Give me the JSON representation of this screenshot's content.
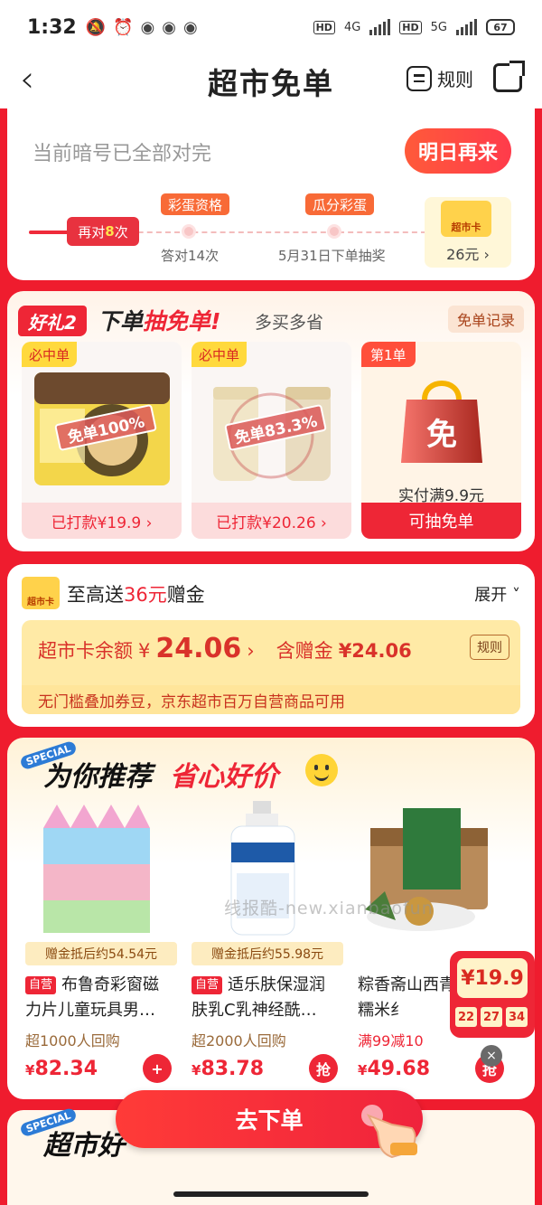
{
  "status": {
    "time": "1:32",
    "net1": "4G",
    "net2": "5G",
    "hd": "HD",
    "battery": "67"
  },
  "nav": {
    "title": "超市免单",
    "rules": "规则"
  },
  "quiz": {
    "done_text": "当前暗号已全部对完",
    "tomorrow_btn": "明日再来",
    "again_prefix": "再对",
    "again_count": "8",
    "again_suffix": "次",
    "milestone1_tag": "彩蛋资格",
    "milestone1_sub": "答对14次",
    "milestone2_tag": "瓜分彩蛋",
    "milestone2_sub": "5月31日下单抽奖",
    "card_label": "超市卡",
    "card_amount": "26元",
    "card_arrow": "›"
  },
  "gift2": {
    "badge": "好礼2",
    "title_a": "下单",
    "title_b": "抽免单!",
    "subtitle": "多买多省",
    "records": "免单记录",
    "products": [
      {
        "tag": "必中单",
        "stamp": "免单100%",
        "footer": "已打款¥19.9 ›"
      },
      {
        "tag": "必中单",
        "stamp": "免单83.3%",
        "footer": "已打款¥20.26 ›"
      }
    ],
    "free_card": {
      "tag": "第1单",
      "bag_text": "免",
      "pay": "实付满9.9元",
      "footer": "可抽免单"
    }
  },
  "supercard": {
    "icon_label": "超市卡",
    "title_prefix": "至高送",
    "title_amount": "36元",
    "title_suffix": "赠金",
    "expand": "展开 ˅",
    "balance_label": "超市卡余额",
    "balance_currency": "¥",
    "balance_value": "24.06",
    "balance_arrow": "›",
    "gift_label": "含赠金",
    "gift_value": "¥24.06",
    "rules": "规则",
    "note": "无门槛叠加券豆，京东超市百万自营商品可用"
  },
  "recommend": {
    "special": "SPECIAL",
    "title_a": "为你推荐",
    "title_b": "省心好价",
    "items": [
      {
        "gift": "赠金抵后约54.54元",
        "self": "自营",
        "name": "布鲁奇彩窗磁力片儿童玩具男…",
        "buyers": "超1000人回购",
        "price": "82.34",
        "btn": "+"
      },
      {
        "gift": "赠金抵后约55.98元",
        "self": "自营",
        "name": "适乐肤保湿润肤乳C乳神经酰…",
        "buyers": "超2000人回购",
        "price": "83.78",
        "btn": "抢"
      },
      {
        "gift": "",
        "self": "",
        "name": "粽香斋山西青子江米糯米纟",
        "buyers": "满99减10",
        "price": "49.68",
        "btn": "抢"
      }
    ]
  },
  "floating": {
    "amount": "¥19.9",
    "h": "22",
    "m": "27",
    "s": "34",
    "close": "×"
  },
  "bottom": {
    "special": "SPECIAL",
    "title": "超市好",
    "order_btn": "去下单"
  },
  "watermark": "线报酷-new.xianbaofun",
  "colors": {
    "accent": "#ee2636",
    "bg": "#ef1c2e",
    "gold": "#ffeaa6"
  }
}
